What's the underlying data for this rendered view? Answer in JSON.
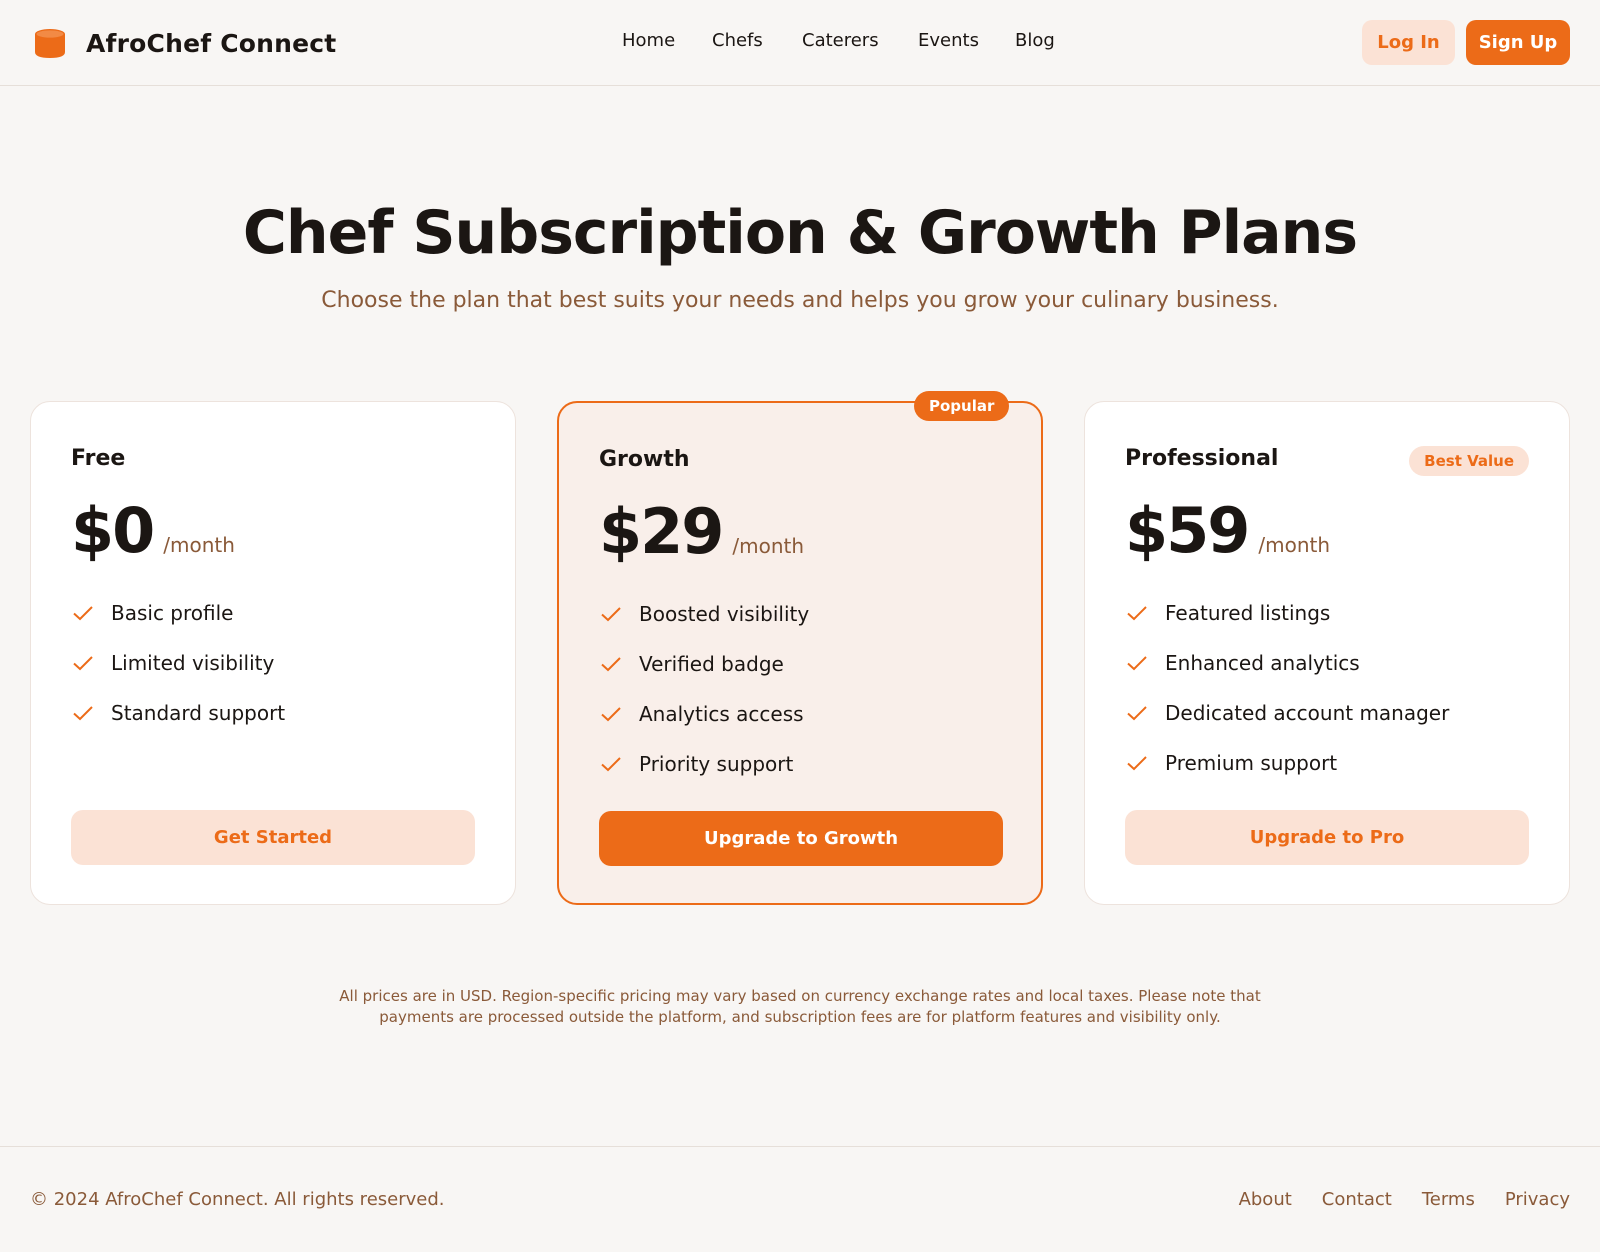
{
  "brand": {
    "name": "AfroChef Connect",
    "logo_icon": "cylinder-icon",
    "accent_color": "#ec6b18"
  },
  "nav": {
    "items": [
      "Home",
      "Chefs",
      "Caterers",
      "Events",
      "Blog"
    ]
  },
  "auth": {
    "login_label": "Log In",
    "signup_label": "Sign Up"
  },
  "hero": {
    "title": "Chef Subscription & Growth Plans",
    "subtitle": "Choose the plan that best suits your needs and helps you grow your culinary business."
  },
  "plans": [
    {
      "name": "Free",
      "price": "$0",
      "period": "/month",
      "badge": "",
      "features": [
        "Basic profile",
        "Limited visibility",
        "Standard support"
      ],
      "cta": "Get Started"
    },
    {
      "name": "Growth",
      "price": "$29",
      "period": "/month",
      "badge": "Popular",
      "features": [
        "Boosted visibility",
        "Verified badge",
        "Analytics access",
        "Priority support"
      ],
      "cta": "Upgrade to Growth"
    },
    {
      "name": "Professional",
      "price": "$59",
      "period": "/month",
      "badge": "Best Value",
      "features": [
        "Featured listings",
        "Enhanced analytics",
        "Dedicated account manager",
        "Premium support"
      ],
      "cta": "Upgrade to Pro"
    }
  ],
  "footnote": "All prices are in USD. Region-specific pricing may vary based on currency exchange rates and local taxes. Please note that payments are processed outside the platform, and subscription fees are for platform features and visibility only.",
  "footer": {
    "copyright": "© 2024 AfroChef Connect. All rights reserved.",
    "links": [
      "About",
      "Contact",
      "Terms",
      "Privacy"
    ]
  }
}
